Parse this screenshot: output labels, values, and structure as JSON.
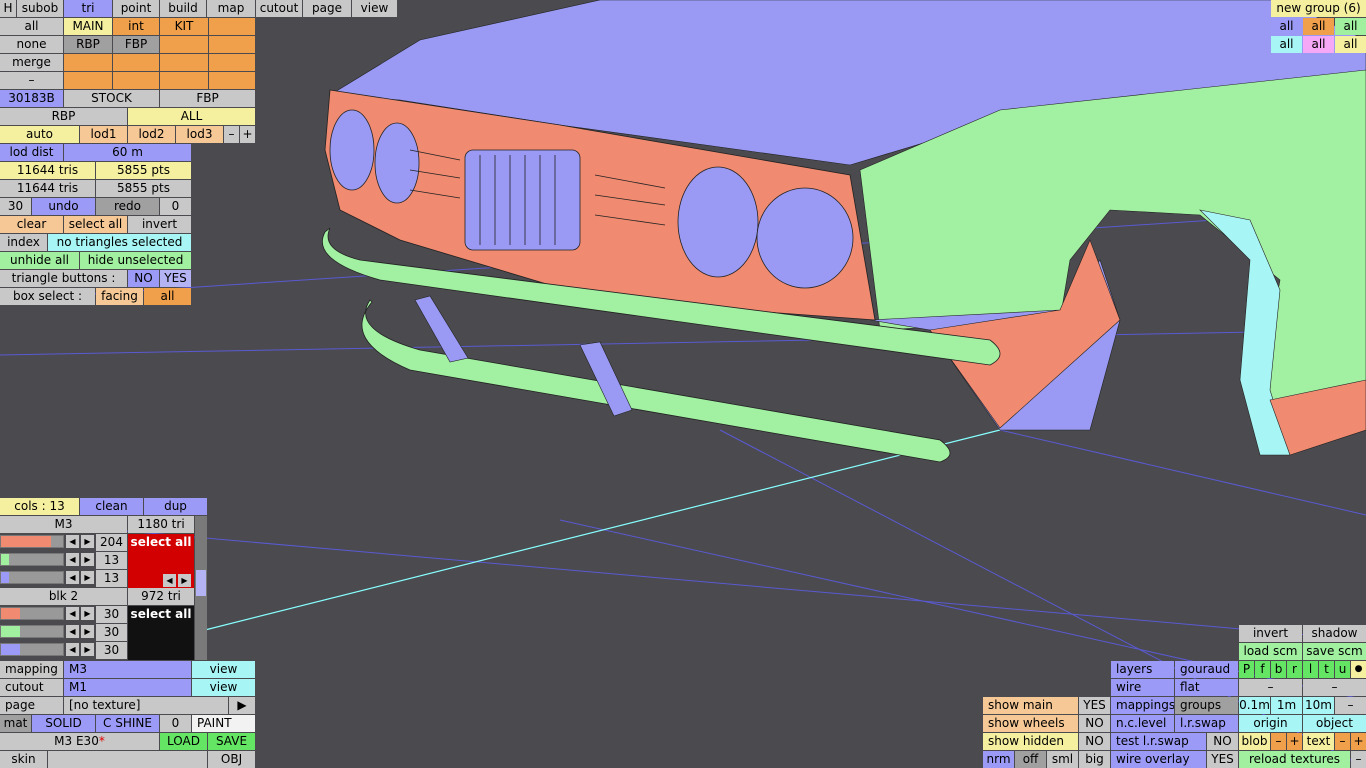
{
  "top_menu": {
    "h": "H",
    "subob": "subob",
    "tri": "tri",
    "point": "point",
    "build": "build",
    "map": "map",
    "cutout": "cutout",
    "page": "page",
    "view": "view"
  },
  "sel": {
    "all": "all",
    "none": "none",
    "merge": "merge",
    "dash": "–",
    "main": "MAIN",
    "int": "int",
    "kit": "KIT",
    "rbp": "RBP",
    "fbp": "FBP"
  },
  "model": {
    "id": "30183B",
    "stock": "STOCK",
    "fbp": "FBP",
    "rbp": "RBP",
    "all": "ALL"
  },
  "lod": {
    "auto": "auto",
    "lod1": "lod1",
    "lod2": "lod2",
    "lod3": "lod3",
    "minus": "–",
    "plus": "+",
    "dist_label": "lod dist",
    "dist_value": "60 m"
  },
  "counts": {
    "tris1": "11644 tris",
    "pts1": "5855 pts",
    "tris2": "11644 tris",
    "pts2": "5855 pts"
  },
  "history": {
    "n": "30",
    "undo": "undo",
    "redo": "redo",
    "z": "0"
  },
  "tri_ops": {
    "clear": "clear",
    "select_all": "select all",
    "invert": "invert",
    "index": "index",
    "index_status": "no triangles selected",
    "unhide_all": "unhide all",
    "hide_unselected": "hide unselected",
    "tri_buttons": "triangle buttons :",
    "no": "NO",
    "yes": "YES",
    "box_select": "box select :",
    "facing": "facing",
    "all": "all"
  },
  "colors": {
    "cols": "cols : 13",
    "clean": "clean",
    "dup": "dup"
  },
  "materials": [
    {
      "name": "M3",
      "tri": "1180 tri",
      "rgb": [
        "204",
        "13",
        "13"
      ],
      "levels": [
        0.8,
        0.13,
        0.13
      ],
      "swatch": "#d20000",
      "select": "select all"
    },
    {
      "name": "blk 2",
      "tri": "972 tri",
      "rgb": [
        "30",
        "30",
        "30"
      ],
      "levels": [
        0.3,
        0.3,
        0.3
      ],
      "swatch": "#111111",
      "select": "select all"
    }
  ],
  "texinfo": {
    "mapping": "mapping",
    "mapping_v": "M3",
    "cutout": "cutout",
    "cutout_v": "M1",
    "page": "page",
    "page_v": "[no texture]",
    "view": "view",
    "play": "▶"
  },
  "matrow": {
    "mat": "mat",
    "solid": "SOLID",
    "cshine": "C SHINE",
    "zero": "0",
    "paint": "PAINT"
  },
  "file": {
    "name": "M3 E30",
    "star": "*",
    "load": "LOAD",
    "save": "SAVE",
    "skin": "skin",
    "obj": "OBJ"
  },
  "groups": {
    "title": "new group (6)",
    "all": "all"
  },
  "show": {
    "main": "show main",
    "wheels": "show wheels",
    "hidden": "show hidden",
    "main_v": "YES",
    "wheels_v": "NO",
    "hidden_v": "NO",
    "nrm": "nrm",
    "off": "off",
    "sml": "sml",
    "big": "big"
  },
  "render": {
    "layers": "layers",
    "gouraud": "gouraud",
    "wire": "wire",
    "flat": "flat",
    "mappings": "mappings",
    "groups": "groups",
    "nclevel": "n.c.level",
    "lrswap": "l.r.swap",
    "test": "test l.r.swap",
    "test_v": "NO",
    "overlay": "wire overlay",
    "overlay_v": "YES"
  },
  "right": {
    "invert": "invert",
    "shadow": "shadow",
    "load_scm": "load scm",
    "save_scm": "save scm",
    "letters": [
      "P",
      "f",
      "b",
      "r",
      "l",
      "t",
      "u",
      "●"
    ],
    "dash": "–",
    "d1": "0.1m",
    "d2": "1m",
    "d3": "10m",
    "origin": "origin",
    "object": "object",
    "blob": "blob",
    "text": "text",
    "minus": "–",
    "plus": "+",
    "reload": "reload textures"
  }
}
